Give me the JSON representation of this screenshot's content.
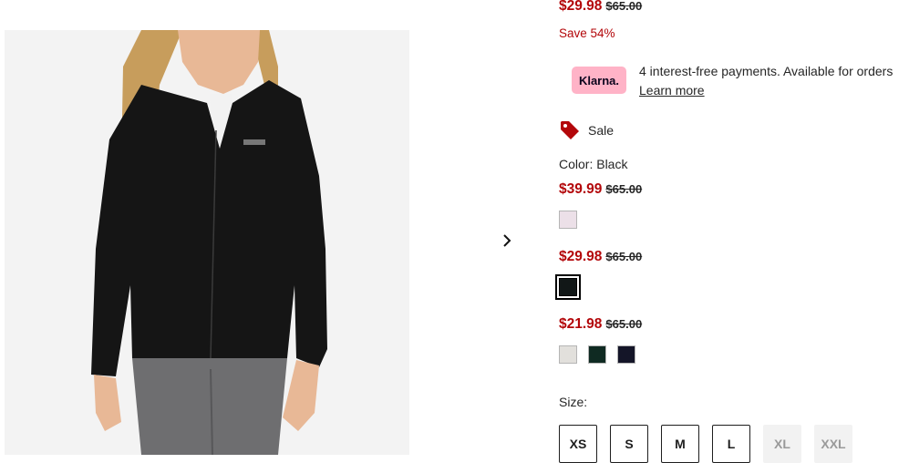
{
  "product": {
    "image_alt": "Black fleece full-zip hooded jacket"
  },
  "price": {
    "current": "$29.98",
    "original": "$65.00",
    "save": "Save 54%"
  },
  "klarna": {
    "logo_text": "Klarna.",
    "text": "4 interest-free payments. Available for orders",
    "link": "Learn more"
  },
  "badge": {
    "icon": "price-tag-icon",
    "label": "Sale"
  },
  "color": {
    "label": "Color: Black",
    "groups": [
      {
        "sale": "$39.99",
        "original": "$65.00",
        "swatches": [
          "#ece0e8"
        ]
      },
      {
        "sale": "$29.98",
        "original": "$65.00",
        "swatches": [
          "#111717"
        ],
        "selected_index": 0
      },
      {
        "sale": "$21.98",
        "original": "$65.00",
        "swatches": [
          "#e2e0dc",
          "#0f2a22",
          "#141528"
        ]
      }
    ]
  },
  "size": {
    "label": "Size:",
    "options": [
      "XS",
      "S",
      "M",
      "L",
      "XL",
      "XXL"
    ],
    "unavailable": [
      "XL",
      "XXL"
    ]
  },
  "colors": {
    "sale_red": "#b3070a",
    "klarna_pink": "#ffb3c7"
  }
}
